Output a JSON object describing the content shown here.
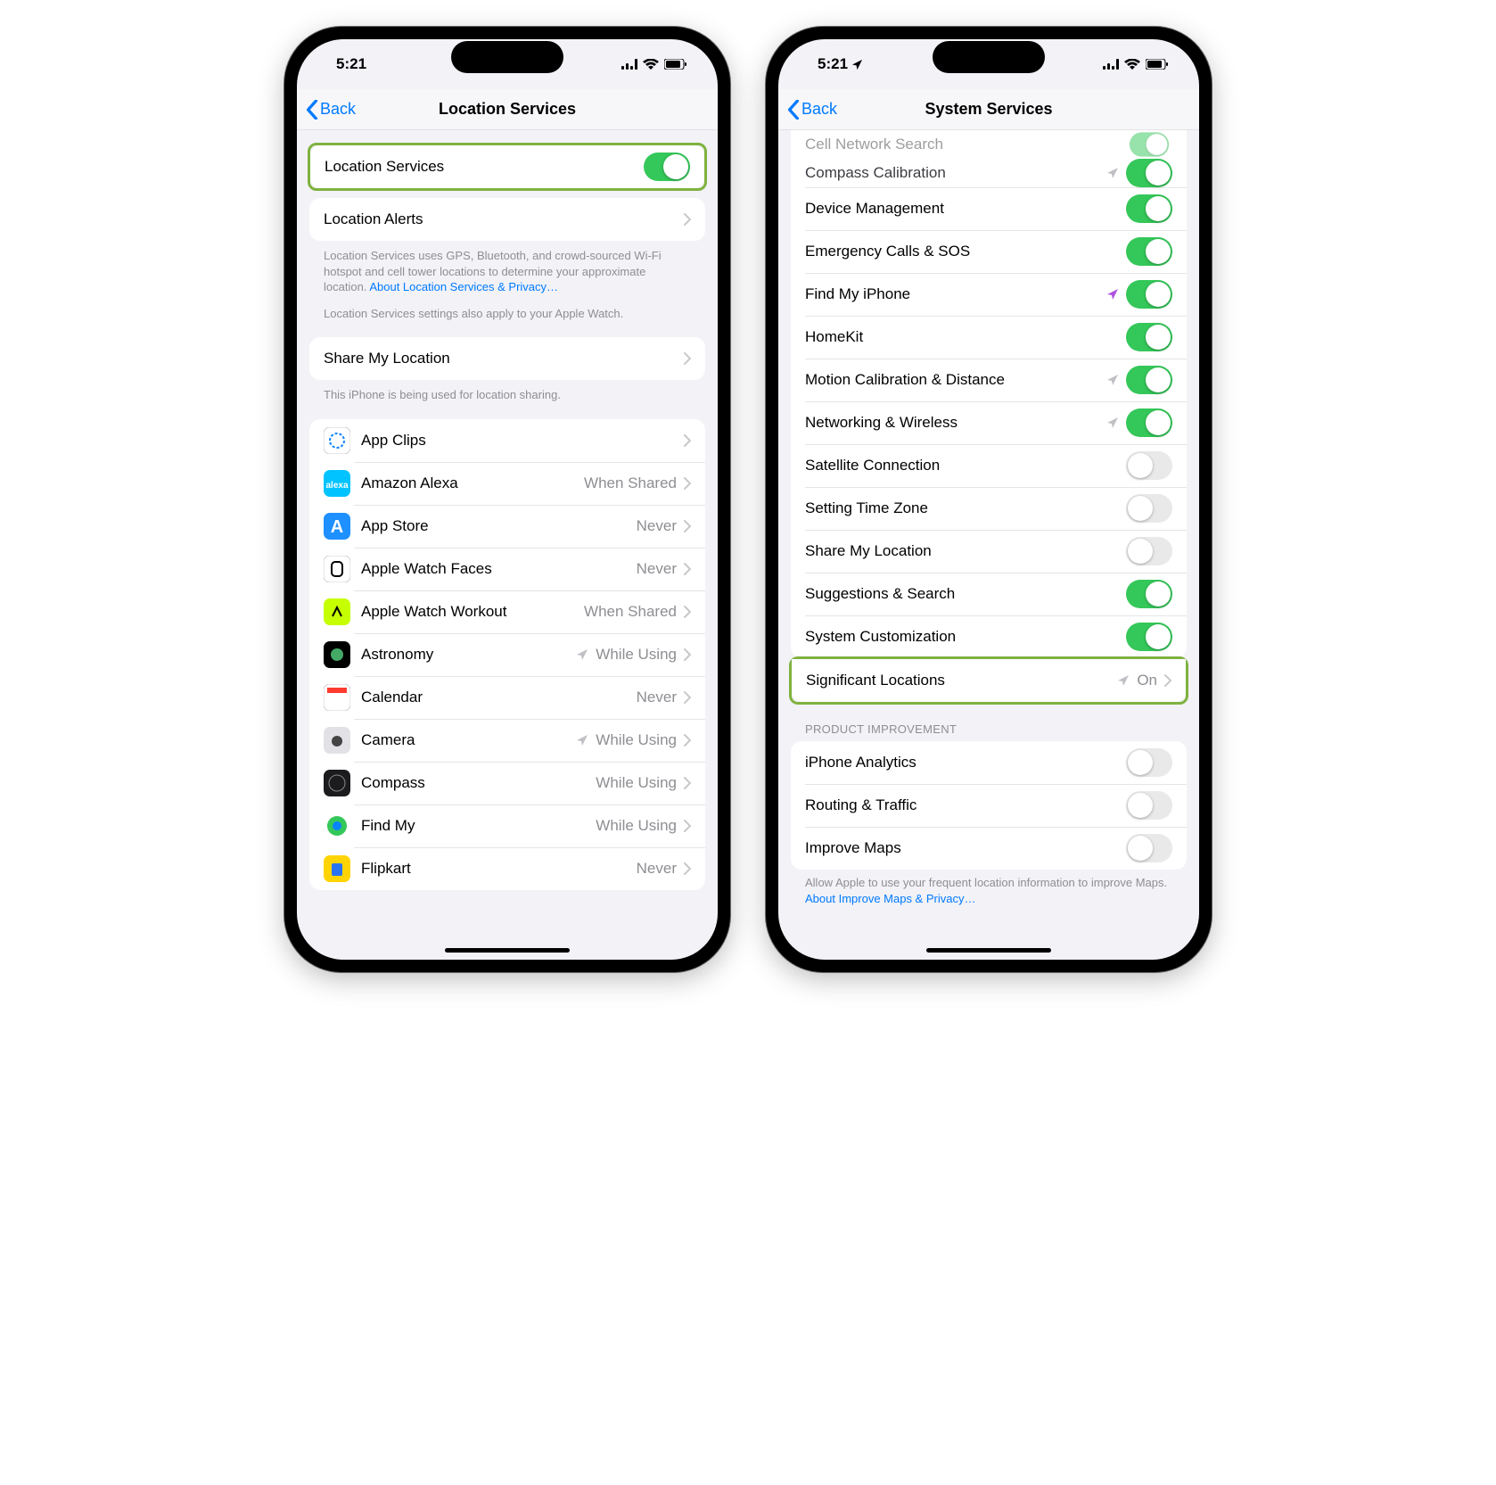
{
  "left": {
    "time": "5:21",
    "nav": {
      "back": "Back",
      "title": "Location Services"
    },
    "locServices": {
      "label": "Location Services",
      "on": true
    },
    "locAlerts": {
      "label": "Location Alerts"
    },
    "footer1a": "Location Services uses GPS, Bluetooth, and crowd-sourced Wi-Fi hotspot and cell tower locations to determine your approximate location. ",
    "footer1b": "About Location Services & Privacy…",
    "footer2": "Location Services settings also apply to your Apple Watch.",
    "share": {
      "label": "Share My Location"
    },
    "footer3": "This iPhone is being used for location sharing.",
    "apps": [
      {
        "name": "App Clips",
        "status": "",
        "icon": "appclips",
        "bg": "#fff",
        "arrow": false
      },
      {
        "name": "Amazon Alexa",
        "status": "When Shared",
        "icon": "alexa",
        "bg": "#00c3ff",
        "arrow": false
      },
      {
        "name": "App Store",
        "status": "Never",
        "icon": "appstore",
        "bg": "#1e90ff",
        "arrow": false
      },
      {
        "name": "Apple Watch Faces",
        "status": "Never",
        "icon": "watchfaces",
        "bg": "#fff",
        "arrow": false
      },
      {
        "name": "Apple Watch Workout",
        "status": "When Shared",
        "icon": "workout",
        "bg": "#b4ff00",
        "arrow": false
      },
      {
        "name": "Astronomy",
        "status": "While Using",
        "icon": "astronomy",
        "bg": "#000",
        "arrow": true
      },
      {
        "name": "Calendar",
        "status": "Never",
        "icon": "calendar",
        "bg": "#fff",
        "arrow": false
      },
      {
        "name": "Camera",
        "status": "While Using",
        "icon": "camera",
        "bg": "#e2e2e6",
        "arrow": true
      },
      {
        "name": "Compass",
        "status": "While Using",
        "icon": "compass",
        "bg": "#1c1c1e",
        "arrow": false
      },
      {
        "name": "Find My",
        "status": "While Using",
        "icon": "findmy",
        "bg": "#34c759",
        "arrow": false
      },
      {
        "name": "Flipkart",
        "status": "Never",
        "icon": "flipkart",
        "bg": "#ffd400",
        "arrow": false
      }
    ]
  },
  "right": {
    "time": "5:21",
    "nav": {
      "back": "Back",
      "title": "System Services"
    },
    "partialTop": "Cell Network Search",
    "items": [
      {
        "name": "Compass Calibration",
        "type": "toggle",
        "on": true,
        "arrow": "gray"
      },
      {
        "name": "Device Management",
        "type": "toggle",
        "on": true,
        "arrow": null
      },
      {
        "name": "Emergency Calls & SOS",
        "type": "toggle",
        "on": true,
        "arrow": null
      },
      {
        "name": "Find My iPhone",
        "type": "toggle",
        "on": true,
        "arrow": "purple"
      },
      {
        "name": "HomeKit",
        "type": "toggle",
        "on": true,
        "arrow": null
      },
      {
        "name": "Motion Calibration & Distance",
        "type": "toggle",
        "on": true,
        "arrow": "gray"
      },
      {
        "name": "Networking & Wireless",
        "type": "toggle",
        "on": true,
        "arrow": "gray"
      },
      {
        "name": "Satellite Connection",
        "type": "toggle",
        "on": false,
        "arrow": null
      },
      {
        "name": "Setting Time Zone",
        "type": "toggle",
        "on": false,
        "arrow": null
      },
      {
        "name": "Share My Location",
        "type": "toggle",
        "on": false,
        "arrow": null
      },
      {
        "name": "Suggestions & Search",
        "type": "toggle",
        "on": true,
        "arrow": null
      },
      {
        "name": "System Customization",
        "type": "toggle",
        "on": true,
        "arrow": null
      }
    ],
    "sig": {
      "name": "Significant Locations",
      "value": "On"
    },
    "section2": "PRODUCT IMPROVEMENT",
    "items2": [
      {
        "name": "iPhone Analytics",
        "on": false
      },
      {
        "name": "Routing & Traffic",
        "on": false
      },
      {
        "name": "Improve Maps",
        "on": false
      }
    ],
    "footerA": "Allow Apple to use your frequent location information to improve Maps. ",
    "footerB": "About Improve Maps & Privacy…"
  }
}
